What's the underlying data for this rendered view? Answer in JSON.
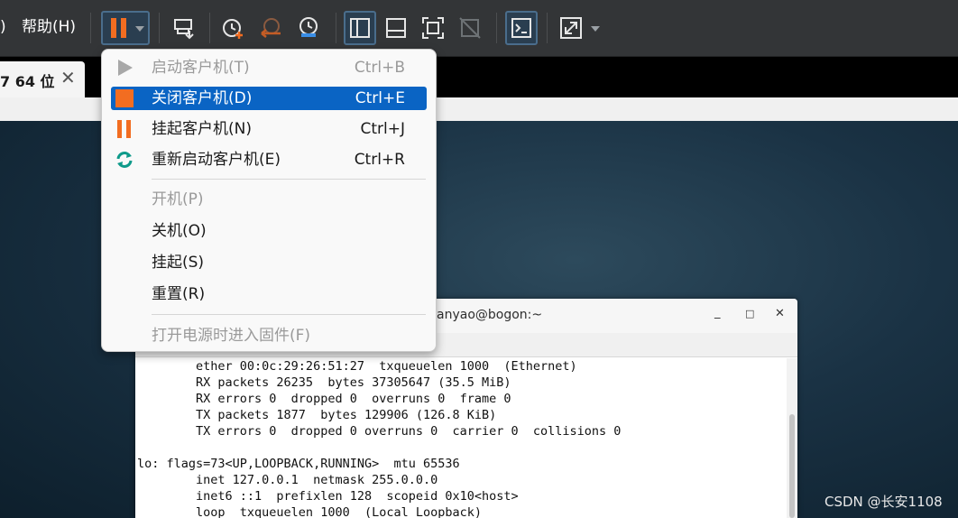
{
  "menubar": {
    "prev_fragment": ")",
    "help": "帮助(H)"
  },
  "tab": {
    "label": "7 64 位"
  },
  "menu": {
    "items": [
      {
        "label": "启动客户机(T)",
        "shortcut": "Ctrl+B",
        "state": "disabled",
        "icon": "play-icon"
      },
      {
        "label": "关闭客户机(D)",
        "shortcut": "Ctrl+E",
        "state": "selected",
        "icon": "stop-icon"
      },
      {
        "label": "挂起客户机(N)",
        "shortcut": "Ctrl+J",
        "state": "normal",
        "icon": "pause-icon"
      },
      {
        "label": "重新启动客户机(E)",
        "shortcut": "Ctrl+R",
        "state": "normal",
        "icon": "restart-icon"
      },
      {
        "label": "开机(P)",
        "shortcut": "",
        "state": "disabled"
      },
      {
        "label": "关机(O)",
        "shortcut": "",
        "state": "normal"
      },
      {
        "label": "挂起(S)",
        "shortcut": "",
        "state": "normal"
      },
      {
        "label": "重置(R)",
        "shortcut": "",
        "state": "normal"
      },
      {
        "label": "打开电源时进入固件(F)",
        "shortcut": "",
        "state": "disabled"
      }
    ]
  },
  "terminal": {
    "title": "anyao@bogon:~",
    "lines": [
      "        ether 00:0c:29:26:51:27  txqueuelen 1000  (Ethernet)",
      "        RX packets 26235  bytes 37305647 (35.5 MiB)",
      "        RX errors 0  dropped 0  overruns 0  frame 0",
      "        TX packets 1877  bytes 129906 (126.8 KiB)",
      "        TX errors 0  dropped 0 overruns 0  carrier 0  collisions 0",
      "",
      "lo: flags=73<UP,LOOPBACK,RUNNING>  mtu 65536",
      "        inet 127.0.0.1  netmask 255.0.0.0",
      "        inet6 ::1  prefixlen 128  scopeid 0x10<host>",
      "        loop  txqueuelen 1000  (Local Loopback)"
    ]
  },
  "watermark": "CSDN @长安1108",
  "colors": {
    "accent_orange": "#f26d21",
    "menu_selection": "#0a64c4",
    "toolbar_bg": "#333537",
    "restart_teal": "#0e9a8a"
  }
}
